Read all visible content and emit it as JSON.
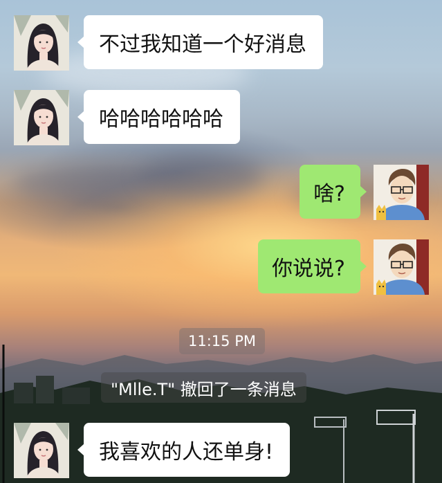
{
  "chat": {
    "messages": [
      {
        "side": "incoming",
        "text": "不过我知道一个好消息",
        "avatar": "girl-avatar"
      },
      {
        "side": "incoming",
        "text": "哈哈哈哈哈哈",
        "avatar": "girl-avatar"
      },
      {
        "side": "outgoing",
        "text": "啥?",
        "avatar": "boy-avatar"
      },
      {
        "side": "outgoing",
        "text": "你说说?",
        "avatar": "boy-avatar"
      },
      {
        "side": "incoming",
        "text": "我喜欢的人还单身!",
        "avatar": "girl-avatar"
      }
    ],
    "timestamp": "11:15 PM",
    "recall_notice": "\"Mlle.T\" 撤回了一条消息"
  },
  "colors": {
    "incoming_bubble": "#ffffff",
    "outgoing_bubble": "#9fe872"
  }
}
